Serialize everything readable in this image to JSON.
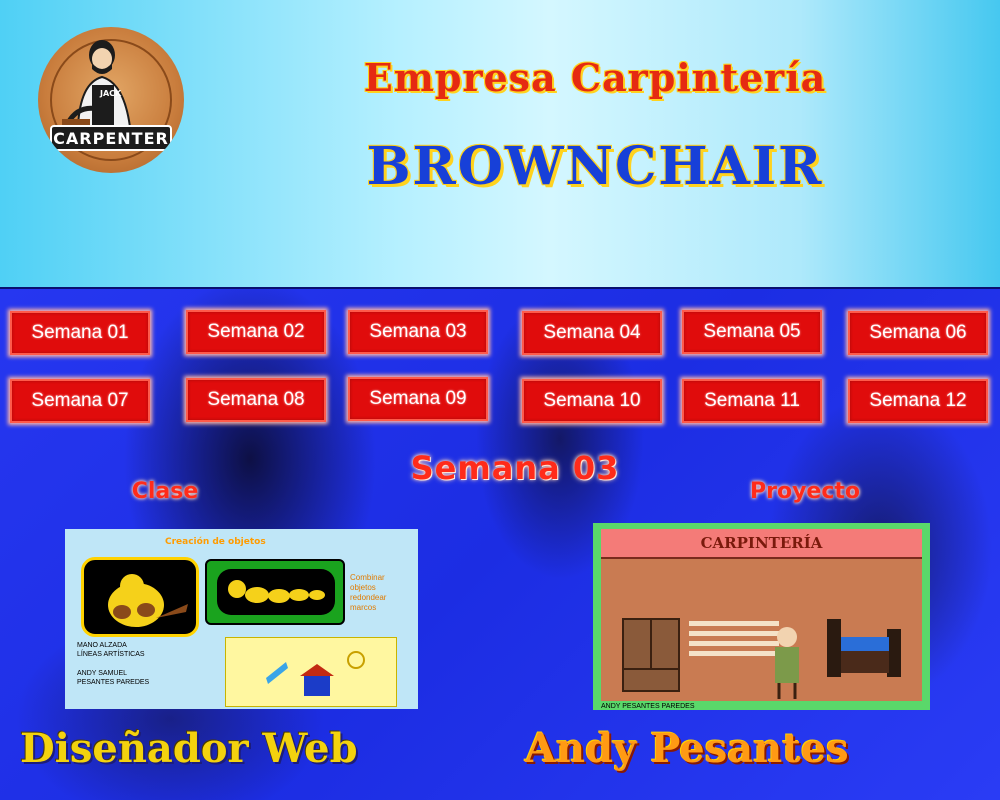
{
  "header": {
    "logo_text": "CARPENTER",
    "logo_badge_name": "JACK",
    "title": "Empresa Carpintería",
    "brand": "BROWNCHAIR"
  },
  "weeks": [
    "Semana 01",
    "Semana 02",
    "Semana 03",
    "Semana 04",
    "Semana 05",
    "Semana 06",
    "Semana 07",
    "Semana 08",
    "Semana 09",
    "Semana 10",
    "Semana 11",
    "Semana 12"
  ],
  "current_section": {
    "title": "Semana 03",
    "class_label": "Clase",
    "project_label": "Proyecto"
  },
  "class_image": {
    "lines_left": "MANO ALZADA\nLÍNEAS ARTÍSTICAS",
    "author": "ANDY SAMUEL\nPESANTES PAREDES",
    "orange_text": "Combinar\nobjetos\nredondear\nmarcos"
  },
  "project_image": {
    "banner": "CARPINTERÍA",
    "credit": "ANDY PESANTES PAREDES"
  },
  "footer": {
    "left": "Diseñador Web",
    "right": "Andy Pesantes"
  },
  "colors": {
    "button_bg": "#e00c0c",
    "main_bg": "#1d2ee6",
    "title_red": "#e52a12",
    "brand_blue": "#1740d8"
  }
}
